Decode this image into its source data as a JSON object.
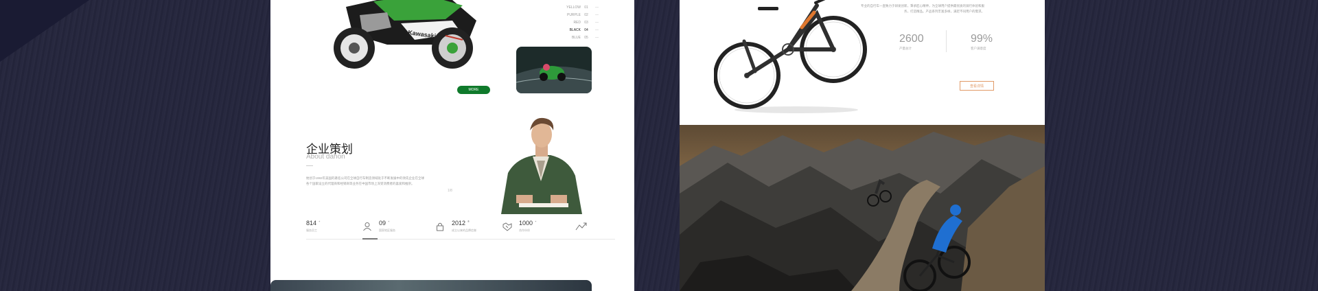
{
  "motorcycle_section": {
    "brand_text": "Kawasaki",
    "colors": [
      {
        "name": "YELLOW",
        "num": "01"
      },
      {
        "name": "PURPLE",
        "num": "02"
      },
      {
        "name": "RED",
        "num": "03"
      },
      {
        "name": "BLACK",
        "num": "04"
      },
      {
        "name": "BLUE",
        "num": "05"
      }
    ],
    "active_color_index": 3,
    "more_label": "MORE"
  },
  "about_section": {
    "title": "企业策划",
    "subtitle": "About dahon",
    "description": "始创于1982年美国的著名公司在全球自行车制造领域处于不断发展中的领先企业在全球各个国家设立的代理商和经销商等业务在中国市场上深受消费者的喜爱和推崇。",
    "side_mark": "1/8"
  },
  "stats": [
    {
      "value": "814",
      "sup": "+",
      "label": "服务员工",
      "icon": "building-icon"
    },
    {
      "value": "09",
      "sup": "+",
      "label": "国家地区服务",
      "icon": "person-icon"
    },
    {
      "value": "2012",
      "sup": "®",
      "label": "成立以来的品牌信誉",
      "icon": "lock-icon"
    },
    {
      "value": "1000",
      "sup": "+",
      "label": "合作伙伴",
      "icon": "handshake-icon"
    },
    {
      "value": "",
      "sup": "",
      "label": "",
      "icon": "trend-icon"
    }
  ],
  "bike_section": {
    "description": "专业的自行车一直致力于研发创新，秉承匠心精神，为全球用户提供最优质的骑行体验和服务，打造精品。产品系列丰富多样，满足不同用户的需求。",
    "stats": [
      {
        "value": "2600",
        "label": "产量总计"
      },
      {
        "value": "99%",
        "label": "客户满意度"
      }
    ],
    "button_label": "查看详情"
  },
  "colors": {
    "page_bg": "#24253c",
    "brand_green": "#0f7a2b",
    "accent_orange": "#e19a66"
  }
}
